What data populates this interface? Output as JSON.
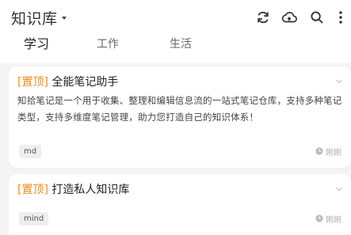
{
  "header": {
    "title": "知识库"
  },
  "toolbar": {
    "icons": [
      "sync-icon",
      "cloud-icon",
      "search-icon",
      "more-icon"
    ]
  },
  "tabs": [
    {
      "label": "学习",
      "active": true
    },
    {
      "label": "工作",
      "active": false
    },
    {
      "label": "生活",
      "active": false
    }
  ],
  "notes": [
    {
      "pin": "[置顶]",
      "title": "全能笔记助手",
      "body": "知拾笔记是一个用于收集、整理和编辑信息流的一站式笔记仓库，支持多种笔记类型，支持多维度笔记管理，助力您打造自己的知识体系！",
      "tag": "md",
      "time": "刚刚"
    },
    {
      "pin": "[置顶]",
      "title": "打造私人知识库",
      "body": "",
      "tag": "mind",
      "time": "刚刚"
    }
  ],
  "colors": {
    "accent": "#f08a18",
    "background": "#f4f4f4",
    "card": "#ffffff"
  }
}
